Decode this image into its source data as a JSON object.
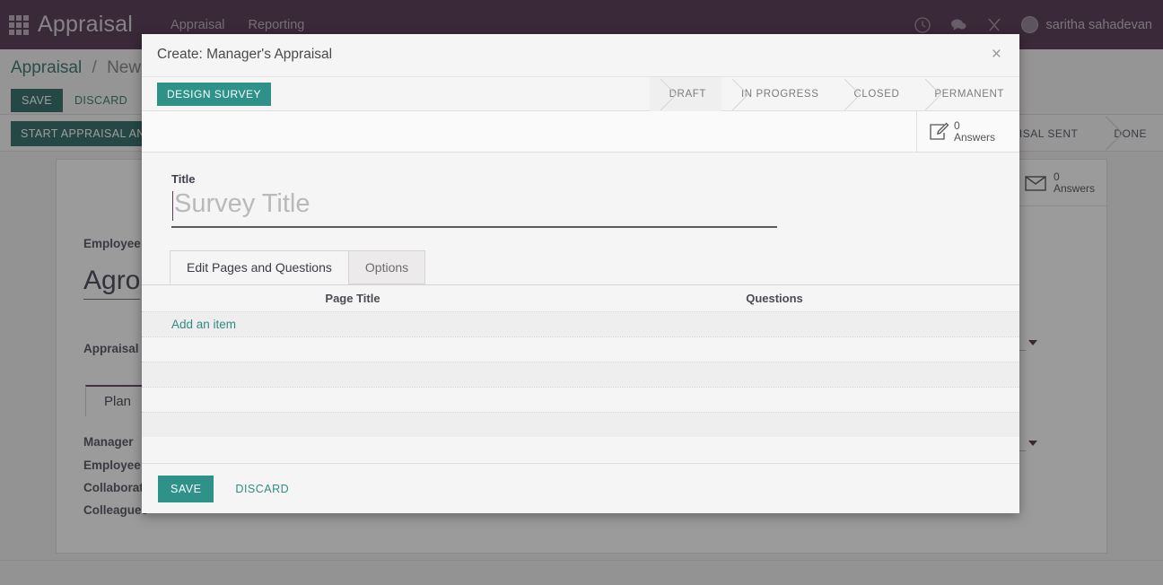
{
  "topbar": {
    "apps_icon": "apps-grid-icon",
    "brand": "Appraisal",
    "menu": [
      {
        "label": "Appraisal"
      },
      {
        "label": "Reporting"
      }
    ],
    "icons": [
      {
        "name": "clock-icon"
      },
      {
        "name": "chat-bubble-icon"
      },
      {
        "name": "tools-icon"
      }
    ],
    "user": {
      "name": "saritha sahadevan",
      "avatar": "user-avatar"
    }
  },
  "background": {
    "breadcrumb": {
      "root": "Appraisal",
      "separator": "/",
      "current": "New"
    },
    "save_label": "SAVE",
    "discard_label": "DISCARD",
    "start_button": "START APPRAISAL AND S",
    "status": [
      {
        "label": "APPRAISAL SENT"
      },
      {
        "label": "DONE"
      }
    ],
    "stat_button": {
      "icon": "envelope-icon",
      "count": "0",
      "unit": "Answers"
    },
    "fields": {
      "employee_label": "Employee",
      "employee_value": "Agro",
      "appraisal_date_label": "Appraisal D",
      "tab_plan": "Plan",
      "manager_label": "Manager",
      "employee2_label": "Employee",
      "collaborators_label": "Collaborato",
      "colleagues_label": "Colleagues"
    }
  },
  "modal": {
    "title": "Create: Manager's Appraisal",
    "close_icon": "close-icon",
    "design_survey_button": "DESIGN SURVEY",
    "status": [
      {
        "label": "DRAFT",
        "active": true
      },
      {
        "label": "IN PROGRESS",
        "active": false
      },
      {
        "label": "CLOSED",
        "active": false
      },
      {
        "label": "PERMANENT",
        "active": false
      }
    ],
    "stat_button": {
      "icon": "pencil-square-icon",
      "count": "0",
      "unit": "Answers"
    },
    "form": {
      "title_label": "Title",
      "title_value": "",
      "title_placeholder": "Survey Title"
    },
    "tabs": [
      {
        "label": "Edit Pages and Questions",
        "active": true
      },
      {
        "label": "Options",
        "active": false
      }
    ],
    "table": {
      "columns": [
        {
          "label": "Page Title"
        },
        {
          "label": "Questions"
        }
      ],
      "add_item_label": "Add an item",
      "empty_rows": 4
    },
    "footer": {
      "save_label": "SAVE",
      "discard_label": "DISCARD"
    }
  },
  "colors": {
    "brand_purple": "#4b2b48",
    "teal_accent": "#2e9289",
    "teal_dark": "#23655e",
    "teal_link": "#2e8c82"
  }
}
